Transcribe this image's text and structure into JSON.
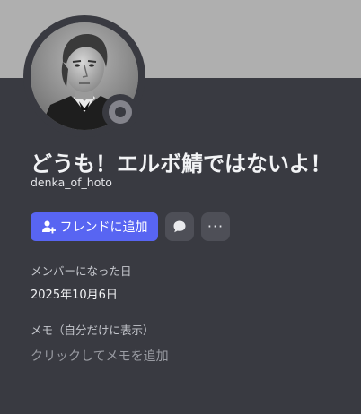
{
  "profile": {
    "display_name": "どうも！エルボ鯖ではないよ！",
    "username": "denka_of_hoto",
    "status": "offline"
  },
  "actions": {
    "add_friend_label": "フレンドに追加"
  },
  "member_since": {
    "label": "メンバーになった日",
    "value": "2025年10月6日"
  },
  "note": {
    "label": "メモ（自分だけに表示）",
    "placeholder": "クリックしてメモを追加"
  },
  "colors": {
    "banner": "#afafaf",
    "background": "#393a41",
    "accent": "#5865f2",
    "status_offline": "#83838b"
  },
  "icons": {
    "add_friend": "person-plus-icon",
    "message": "speech-bubble-icon",
    "more": "ellipsis-icon"
  }
}
